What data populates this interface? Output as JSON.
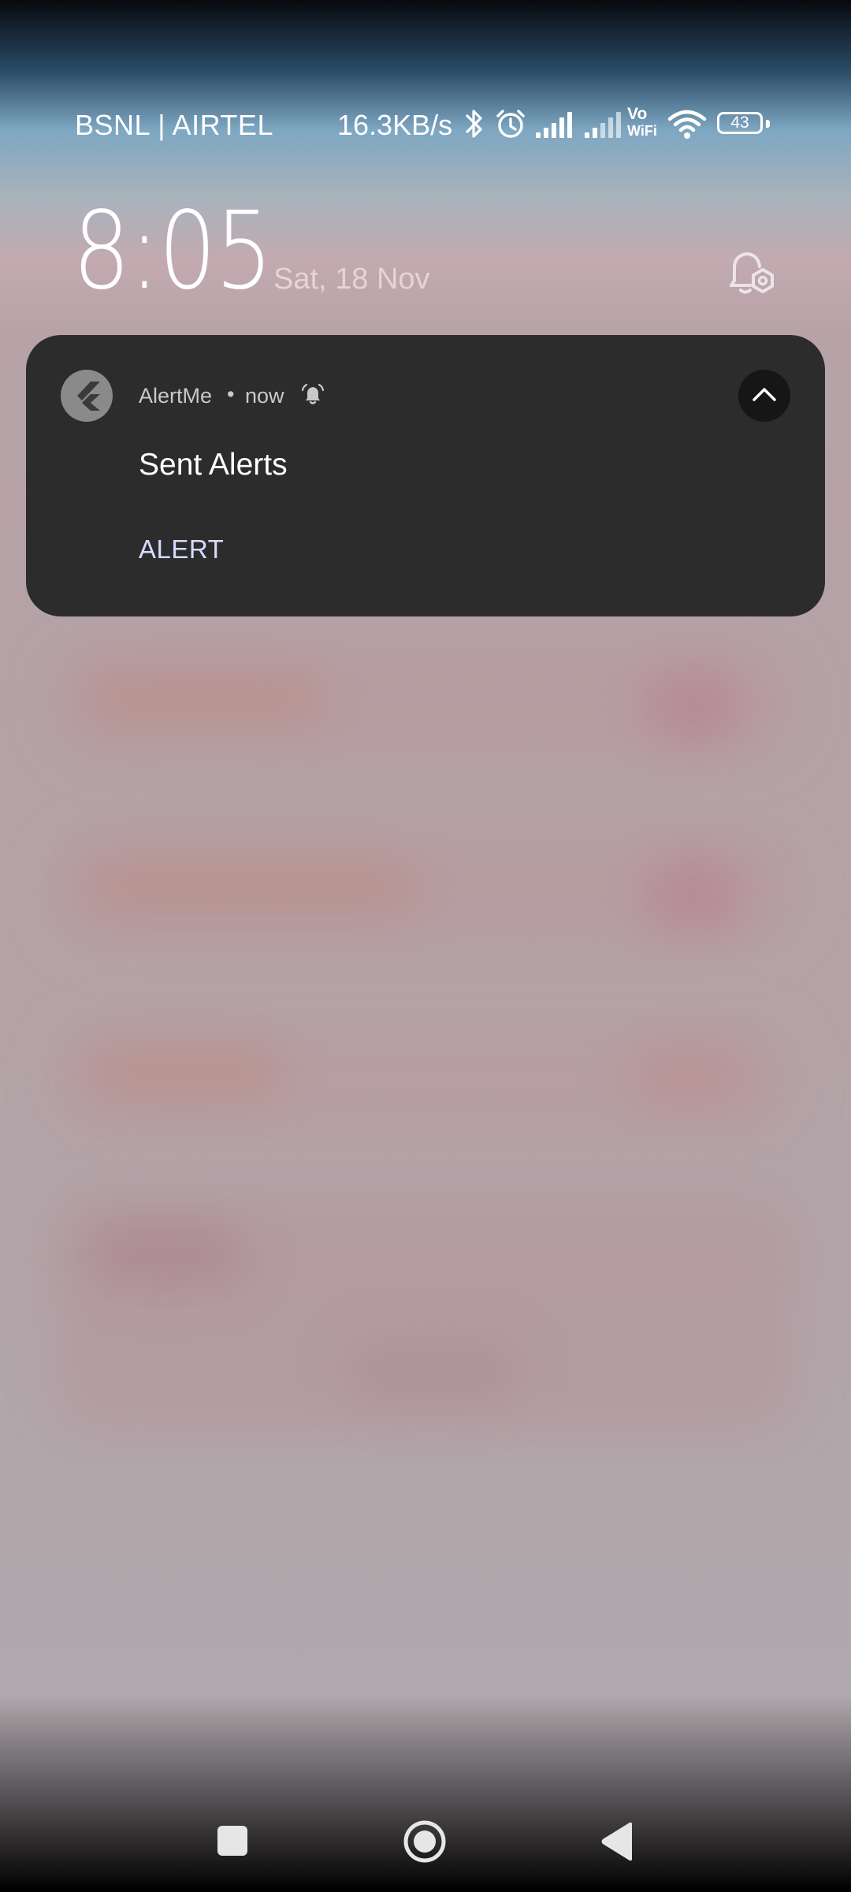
{
  "status_bar": {
    "carrier": "BSNL | AIRTEL",
    "network_speed": "16.3KB/s",
    "battery_level": "43",
    "icons": [
      "bluetooth-icon",
      "alarm-icon",
      "signal-sim1-icon",
      "signal-sim2-icon",
      "vowifi-icon",
      "wifi-icon",
      "battery-icon"
    ],
    "vowifi_top": "Vo",
    "vowifi_bottom": "WiFi"
  },
  "lockscreen": {
    "time": "8:05",
    "date": "Sat, 18 Nov",
    "settings_icon": "notification-settings-icon"
  },
  "notification": {
    "app_name": "AlertMe",
    "separator": "•",
    "timestamp": "now",
    "app_icon": "flutter-logo-icon",
    "alert_icon": "bell-icon",
    "title": "Sent Alerts",
    "action_label": "ALERT",
    "expand_icon": "chevron-up-icon"
  },
  "navigation": {
    "buttons": [
      "recents-button",
      "home-button",
      "back-button"
    ]
  },
  "colors": {
    "card_background": "#2c2c2c",
    "action_text": "#d7dcff",
    "collapse_button": "#161616"
  }
}
